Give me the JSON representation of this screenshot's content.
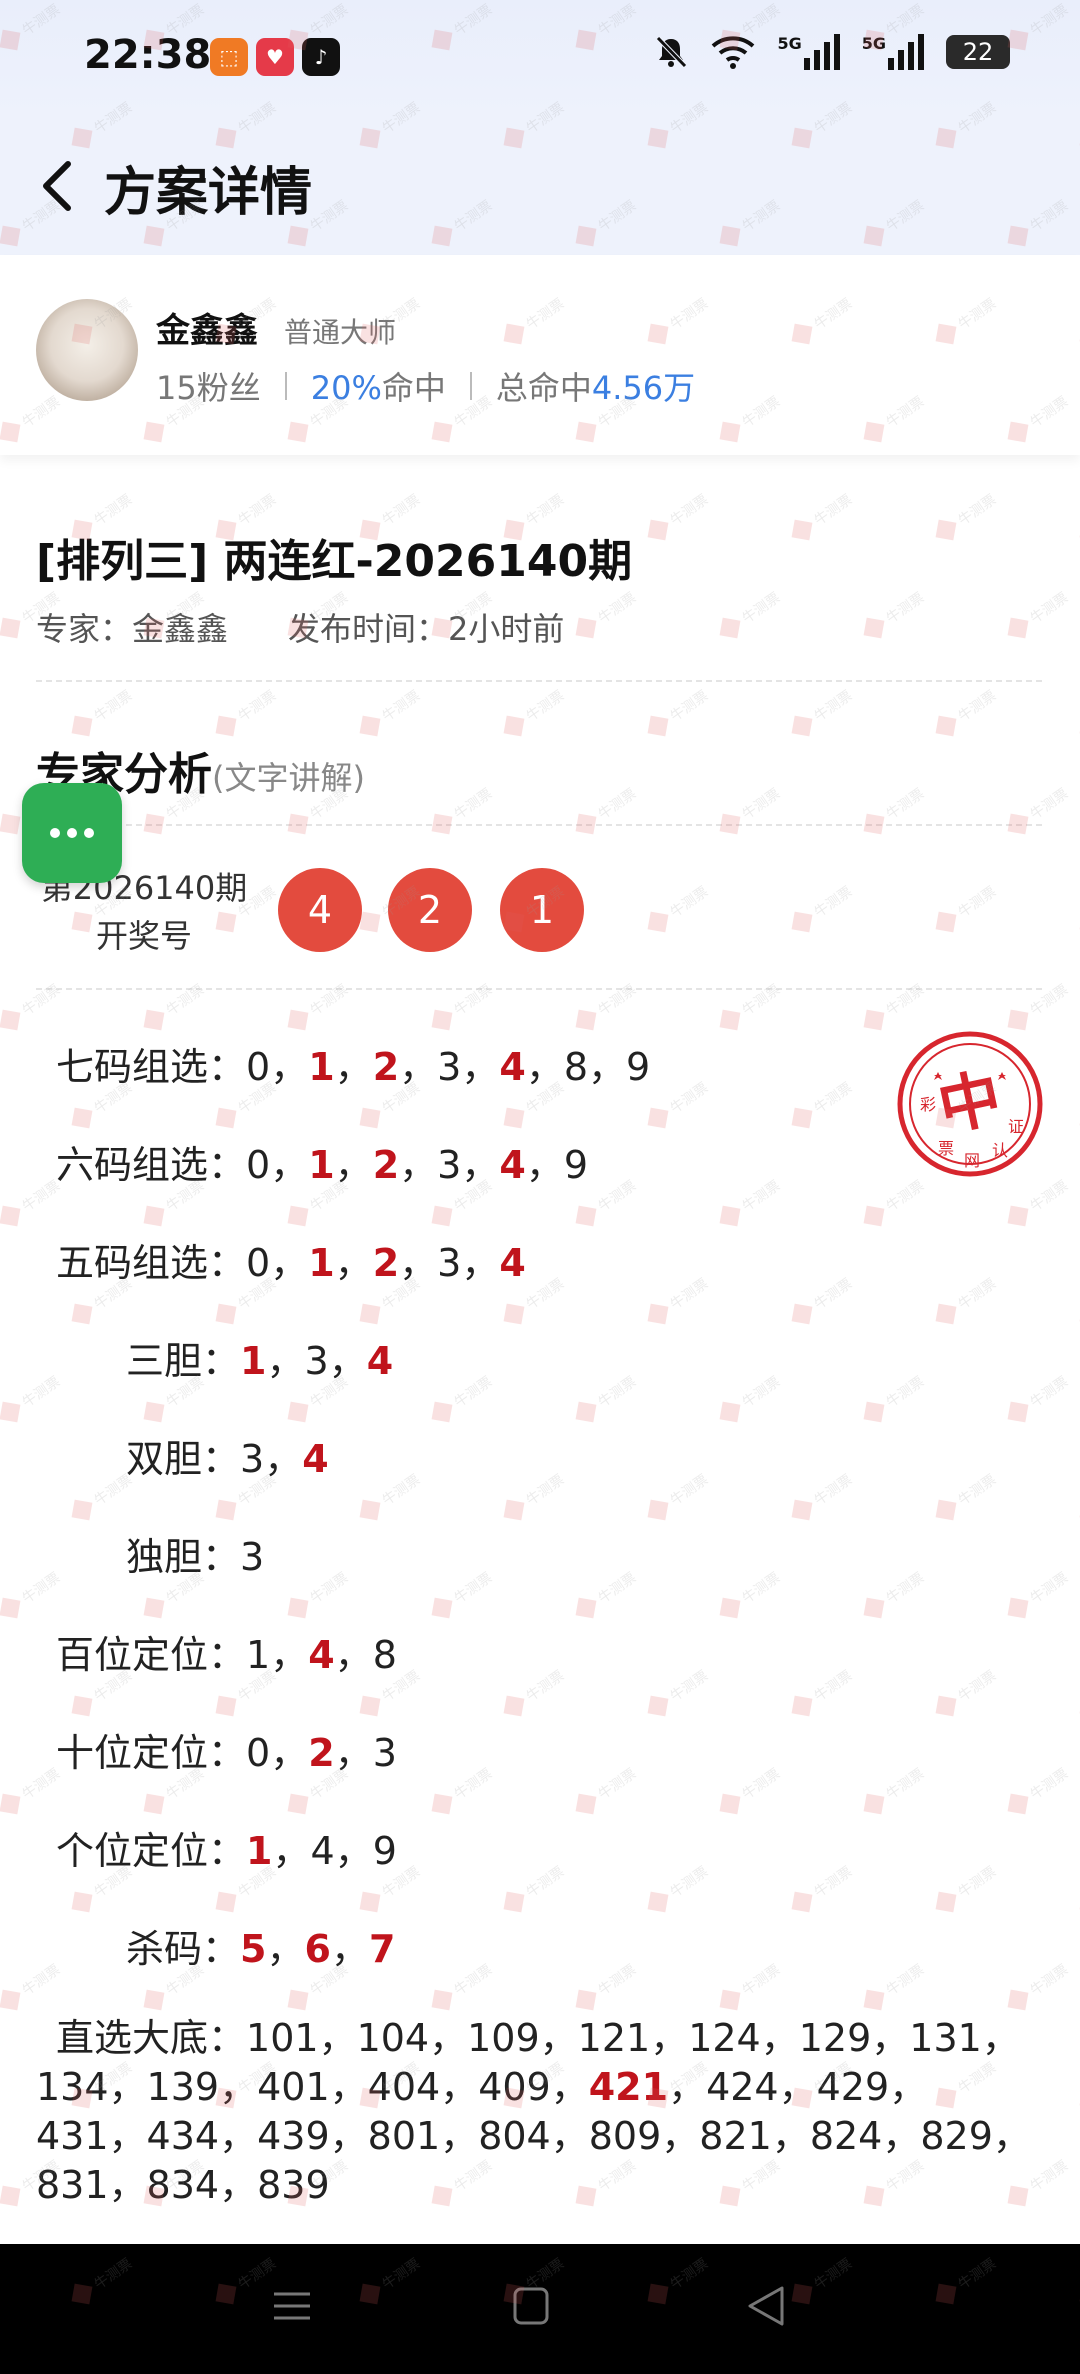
{
  "status_bar": {
    "time": "22:38",
    "battery": "22",
    "network_labels": [
      "5G",
      "5G"
    ],
    "icons": [
      "dnd-bell-icon",
      "wifi-icon",
      "signal-icon",
      "signal-icon",
      "battery-icon"
    ],
    "app_icons": [
      "app-icon-orange",
      "app-icon-red",
      "douyin-icon"
    ]
  },
  "header": {
    "title": "方案详情",
    "back_icon": "chevron-left-icon"
  },
  "expert": {
    "name": "金鑫鑫",
    "level": "普通大师",
    "fans": "15粉丝",
    "hit_rate_value": "20%",
    "hit_rate_label": "命中",
    "total_hit_label": "总命中",
    "total_hit_value": "4.56万"
  },
  "plan": {
    "title": "[排列三] 两连红-2026140期",
    "expert_label": "专家：金鑫鑫",
    "publish_label": "发布时间：2小时前"
  },
  "analysis": {
    "title": "专家分析",
    "subtitle": "(文字讲解)",
    "draw_label_line1": "第2026140期",
    "draw_label_line2": "开奖号",
    "draw_numbers": [
      "4",
      "2",
      "1"
    ]
  },
  "predictions": [
    {
      "label": "七码组选：",
      "items": [
        {
          "v": "0",
          "h": false
        },
        {
          "v": "1",
          "h": true
        },
        {
          "v": "2",
          "h": true
        },
        {
          "v": "3",
          "h": false
        },
        {
          "v": "4",
          "h": true
        },
        {
          "v": "8",
          "h": false
        },
        {
          "v": "9",
          "h": false
        }
      ]
    },
    {
      "label": "六码组选：",
      "items": [
        {
          "v": "0",
          "h": false
        },
        {
          "v": "1",
          "h": true
        },
        {
          "v": "2",
          "h": true
        },
        {
          "v": "3",
          "h": false
        },
        {
          "v": "4",
          "h": true
        },
        {
          "v": "9",
          "h": false
        }
      ]
    },
    {
      "label": "五码组选：",
      "items": [
        {
          "v": "0",
          "h": false
        },
        {
          "v": "1",
          "h": true
        },
        {
          "v": "2",
          "h": true
        },
        {
          "v": "3",
          "h": false
        },
        {
          "v": "4",
          "h": true
        }
      ]
    },
    {
      "label": "三胆：",
      "items": [
        {
          "v": "1",
          "h": true
        },
        {
          "v": "3",
          "h": false
        },
        {
          "v": "4",
          "h": true
        }
      ]
    },
    {
      "label": "双胆：",
      "items": [
        {
          "v": "3",
          "h": false
        },
        {
          "v": "4",
          "h": true
        }
      ]
    },
    {
      "label": "独胆：",
      "items": [
        {
          "v": "3",
          "h": false
        }
      ]
    },
    {
      "label": "百位定位：",
      "items": [
        {
          "v": "1",
          "h": false
        },
        {
          "v": "4",
          "h": true
        },
        {
          "v": "8",
          "h": false
        }
      ]
    },
    {
      "label": "十位定位：",
      "items": [
        {
          "v": "0",
          "h": false
        },
        {
          "v": "2",
          "h": true
        },
        {
          "v": "3",
          "h": false
        }
      ]
    },
    {
      "label": "个位定位：",
      "items": [
        {
          "v": "1",
          "h": true
        },
        {
          "v": "4",
          "h": false
        },
        {
          "v": "9",
          "h": false
        }
      ]
    },
    {
      "label": "杀码：",
      "items": [
        {
          "v": "5",
          "h": true
        },
        {
          "v": "6",
          "h": true
        },
        {
          "v": "7",
          "h": true
        }
      ]
    }
  ],
  "direct": {
    "label": "直选大底：",
    "items": [
      {
        "v": "101",
        "h": false
      },
      {
        "v": "104",
        "h": false
      },
      {
        "v": "109",
        "h": false
      },
      {
        "v": "121",
        "h": false
      },
      {
        "v": "124",
        "h": false
      },
      {
        "v": "129",
        "h": false
      },
      {
        "v": "131",
        "h": false
      },
      {
        "v": "134",
        "h": false
      },
      {
        "v": "139",
        "h": false
      },
      {
        "v": "401",
        "h": false
      },
      {
        "v": "404",
        "h": false
      },
      {
        "v": "409",
        "h": false
      },
      {
        "v": "421",
        "h": true
      },
      {
        "v": "424",
        "h": false
      },
      {
        "v": "429",
        "h": false
      },
      {
        "v": "431",
        "h": false
      },
      {
        "v": "434",
        "h": false
      },
      {
        "v": "439",
        "h": false
      },
      {
        "v": "801",
        "h": false
      },
      {
        "v": "804",
        "h": false
      },
      {
        "v": "809",
        "h": false
      },
      {
        "v": "821",
        "h": false
      },
      {
        "v": "824",
        "h": false
      },
      {
        "v": "829",
        "h": false
      },
      {
        "v": "831",
        "h": false
      },
      {
        "v": "834",
        "h": false
      },
      {
        "v": "839",
        "h": false
      }
    ]
  },
  "stamp": {
    "center_char": "中",
    "ring_chars": [
      "彩",
      "票",
      "网",
      "认",
      "证"
    ]
  },
  "watermark": {
    "text": "牛测票"
  },
  "colors": {
    "accent_blue": "#3b7fe1",
    "ball_red": "#e34b3e",
    "highlight_red": "#c0141c",
    "chat_green": "#2eae55"
  }
}
